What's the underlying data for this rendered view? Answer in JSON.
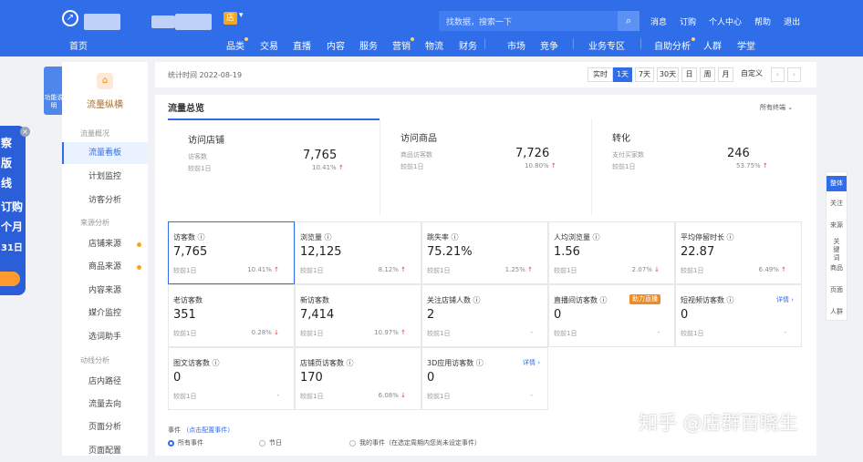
{
  "header": {
    "shop_tag": "店",
    "search_placeholder": "找数据，搜索一下",
    "links": [
      "消息",
      "订购",
      "个人中心",
      "帮助",
      "退出"
    ]
  },
  "nav": [
    "首页",
    "品类",
    "交易",
    "直播",
    "内容",
    "服务",
    "营销",
    "物流",
    "财务",
    "市场",
    "竞争",
    "业务专区",
    "自助分析",
    "人群",
    "学堂"
  ],
  "left_badge": "功能说明",
  "left_promo": [
    "察",
    "版",
    "线",
    "订购",
    "个月",
    "31日"
  ],
  "sidebar": {
    "title": "流量纵横",
    "sections": [
      {
        "label": "流量概况",
        "items": [
          "流量看板",
          "计划监控",
          "访客分析"
        ]
      },
      {
        "label": "来源分析",
        "items": [
          "店铺来源",
          "商品来源",
          "内容来源",
          "媒介监控",
          "选词助手"
        ]
      },
      {
        "label": "动线分析",
        "items": [
          "店内路径",
          "流量去向",
          "页面分析",
          "页面配置"
        ]
      }
    ]
  },
  "datebar": {
    "stat_time": "统计时间 2022-08-19",
    "buttons": [
      "实时",
      "1天",
      "7天",
      "30天",
      "日",
      "周",
      "月",
      "自定义",
      "‹",
      "›"
    ],
    "active": "1天"
  },
  "panel": {
    "title": "流量总览",
    "terminal": "所有终端",
    "big": [
      {
        "title": "访问店铺",
        "sub": "访客数",
        "value": "7,765",
        "cmp": "较前1日",
        "pct": "10.41%",
        "dir": "up"
      },
      {
        "title": "访问商品",
        "sub": "商品访客数",
        "value": "7,726",
        "cmp": "较前1日",
        "pct": "10.80%",
        "dir": "up"
      },
      {
        "title": "转化",
        "sub": "支付买家数",
        "value": "246",
        "cmp": "较前1日",
        "pct": "53.75%",
        "dir": "up"
      }
    ],
    "metrics": [
      {
        "title": "访客数",
        "value": "7,765",
        "cmp": "较前1日",
        "pct": "10.41%",
        "dir": "up"
      },
      {
        "title": "浏览量",
        "value": "12,125",
        "cmp": "较前1日",
        "pct": "8.12%",
        "dir": "up"
      },
      {
        "title": "跳失率",
        "value": "75.21%",
        "cmp": "较前1日",
        "pct": "1.25%",
        "dir": "up"
      },
      {
        "title": "人均浏览量",
        "value": "1.56",
        "cmp": "较前1日",
        "pct": "2.07%",
        "dir": "down"
      },
      {
        "title": "平均停留时长",
        "value": "22.87",
        "cmp": "较前1日",
        "pct": "6.49%",
        "dir": "up"
      },
      {
        "title": "老访客数",
        "value": "351",
        "cmp": "较前1日",
        "pct": "0.28%",
        "dir": "down"
      },
      {
        "title": "新访客数",
        "value": "7,414",
        "cmp": "较前1日",
        "pct": "10.97%",
        "dir": "up"
      },
      {
        "title": "关注店铺人数",
        "value": "2",
        "cmp": "较前1日",
        "pct": "-",
        "dir": ""
      },
      {
        "title": "直播间访客数",
        "value": "0",
        "cmp": "较前1日",
        "pct": "-",
        "dir": "",
        "tag": "助力直播"
      },
      {
        "title": "短视频访客数",
        "value": "0",
        "cmp": "较前1日",
        "pct": "-",
        "dir": "",
        "link": "详情 ›"
      },
      {
        "title": "图文访客数",
        "value": "0",
        "cmp": "较前1日",
        "pct": "-",
        "dir": ""
      },
      {
        "title": "店铺页访客数",
        "value": "170",
        "cmp": "较前1日",
        "pct": "6.08%",
        "dir": "down"
      },
      {
        "title": "3D应用访客数",
        "value": "0",
        "cmp": "较前1日",
        "pct": "-",
        "dir": "",
        "link": "详情 ›"
      }
    ],
    "events_label": "事件",
    "events_config": "（点击配置事件）",
    "radios": [
      "所有事件",
      "节日",
      "我的事件（在选定周期内您尚未设定事件）"
    ]
  },
  "right_tabs": [
    "整体",
    "关注",
    "来源",
    "关键词",
    "商品",
    "页面",
    "人群"
  ],
  "watermark": "知乎 @店群百晓生",
  "colors": {
    "brand": "#2f6ee8",
    "up": "#e23b3b",
    "down": "#22a06b",
    "accent": "#f08a24"
  }
}
